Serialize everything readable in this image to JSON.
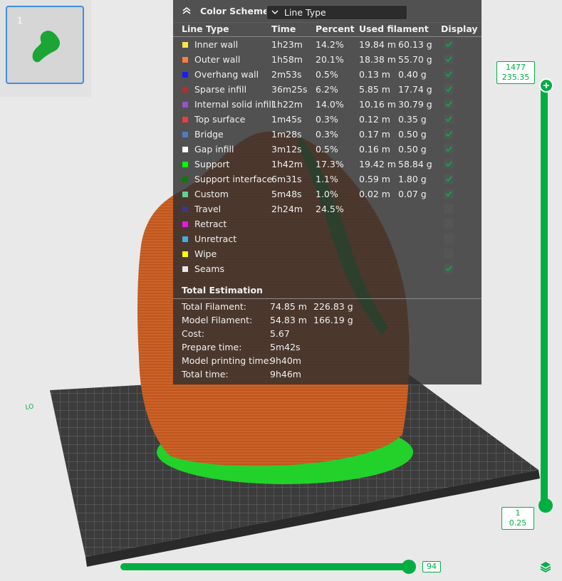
{
  "plate": {
    "number": "1"
  },
  "legend": {
    "title": "Color Scheme",
    "selected": "Line Type",
    "columns": {
      "type": "Line Type",
      "time": "Time",
      "percent": "Percent",
      "filament": "Used filament",
      "display": "Display"
    },
    "rows": [
      {
        "name": "Inner wall",
        "color": "#ffe44d",
        "time": "1h23m",
        "percent": "14.2%",
        "length": "19.84 m",
        "weight": "60.13 g",
        "display": true
      },
      {
        "name": "Outer wall",
        "color": "#ff7d38",
        "time": "1h58m",
        "percent": "20.1%",
        "length": "18.38 m",
        "weight": "55.70 g",
        "display": true
      },
      {
        "name": "Overhang wall",
        "color": "#1a1aff",
        "time": "2m53s",
        "percent": "0.5%",
        "length": "0.13 m",
        "weight": "0.40 g",
        "display": true
      },
      {
        "name": "Sparse infill",
        "color": "#b03029",
        "time": "36m25s",
        "percent": "6.2%",
        "length": "5.85 m",
        "weight": "17.74 g",
        "display": true
      },
      {
        "name": "Internal solid infill",
        "color": "#9654cc",
        "time": "1h22m",
        "percent": "14.0%",
        "length": "10.16 m",
        "weight": "30.79 g",
        "display": true
      },
      {
        "name": "Top surface",
        "color": "#f03c3c",
        "time": "1m45s",
        "percent": "0.3%",
        "length": "0.12 m",
        "weight": "0.35 g",
        "display": true
      },
      {
        "name": "Bridge",
        "color": "#4d80ba",
        "time": "1m28s",
        "percent": "0.3%",
        "length": "0.17 m",
        "weight": "0.50 g",
        "display": true
      },
      {
        "name": "Gap infill",
        "color": "#ffffff",
        "time": "3m12s",
        "percent": "0.5%",
        "length": "0.16 m",
        "weight": "0.50 g",
        "display": true
      },
      {
        "name": "Support",
        "color": "#00ff00",
        "time": "1h42m",
        "percent": "17.3%",
        "length": "19.42 m",
        "weight": "58.84 g",
        "display": true
      },
      {
        "name": "Support interface",
        "color": "#008000",
        "time": "6m31s",
        "percent": "1.1%",
        "length": "0.59 m",
        "weight": "1.80 g",
        "display": true
      },
      {
        "name": "Custom",
        "color": "#5ed194",
        "time": "5m48s",
        "percent": "1.0%",
        "length": "0.02 m",
        "weight": "0.07 g",
        "display": true
      },
      {
        "name": "Travel",
        "color": "#383894",
        "time": "2h24m",
        "percent": "24.5%",
        "length": "",
        "weight": "",
        "display": false
      },
      {
        "name": "Retract",
        "color": "#e61ae6",
        "time": "",
        "percent": "",
        "length": "",
        "weight": "",
        "display": false
      },
      {
        "name": "Unretract",
        "color": "#3dafe0",
        "time": "",
        "percent": "",
        "length": "",
        "weight": "",
        "display": false
      },
      {
        "name": "Wipe",
        "color": "#ffff00",
        "time": "",
        "percent": "",
        "length": "",
        "weight": "",
        "display": false
      },
      {
        "name": "Seams",
        "color": "#e6e6e6",
        "time": "",
        "percent": "",
        "length": "",
        "weight": "",
        "display": true
      }
    ]
  },
  "estimation": {
    "title": "Total Estimation",
    "items": [
      {
        "label": "Total Filament:",
        "v1": "74.85 m",
        "v2": "226.83 g"
      },
      {
        "label": "Model Filament:",
        "v1": "54.83 m",
        "v2": "166.19 g"
      },
      {
        "label": "Cost:",
        "v1": "5.67",
        "v2": ""
      },
      {
        "label": "Prepare time:",
        "v1": "5m42s",
        "v2": ""
      },
      {
        "label": "Model printing time:",
        "v1": "9h40m",
        "v2": ""
      },
      {
        "label": "Total time:",
        "v1": "9h46m",
        "v2": ""
      }
    ]
  },
  "layer_slider": {
    "top_layer": "1477",
    "top_height": "235.35",
    "bottom_layer": "1",
    "bottom_height": "0.25"
  },
  "move_slider": {
    "value": "94"
  },
  "colors": {
    "accent": "#00ae42",
    "model": "#c4581f",
    "support": "#22d22a"
  },
  "icons": {
    "collapse": "chevron-up-double-icon",
    "dropdown": "chevron-down-icon",
    "check": "check-icon",
    "layers": "layers-icon",
    "plus": "plus-icon"
  }
}
